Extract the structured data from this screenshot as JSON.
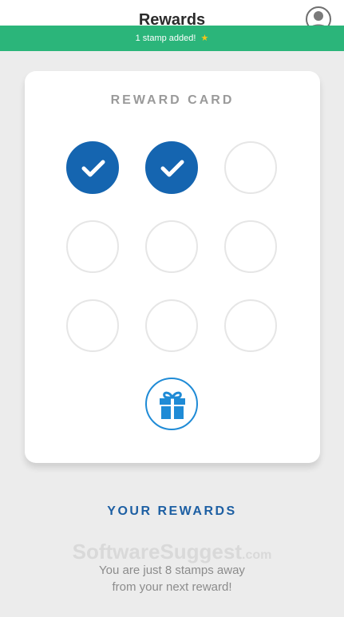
{
  "header": {
    "title": "Rewards",
    "profile_icon": "user-avatar-icon"
  },
  "toast": {
    "message": "1 stamp added!",
    "icon": "star-icon",
    "accent": "#f5c518",
    "background": "#2bb57a"
  },
  "reward_card": {
    "title": "REWARD CARD",
    "stamps_total": 9,
    "stamps_collected": 2,
    "stamp_color": "#1565b0",
    "reward_icon": "gift-icon"
  },
  "your_rewards": {
    "title": "YOUR REWARDS",
    "message_line1": "You are just 8 stamps away",
    "message_line2": "from your next reward!"
  },
  "watermark": {
    "brand": "SoftwareSuggest",
    "suffix": ".com"
  }
}
